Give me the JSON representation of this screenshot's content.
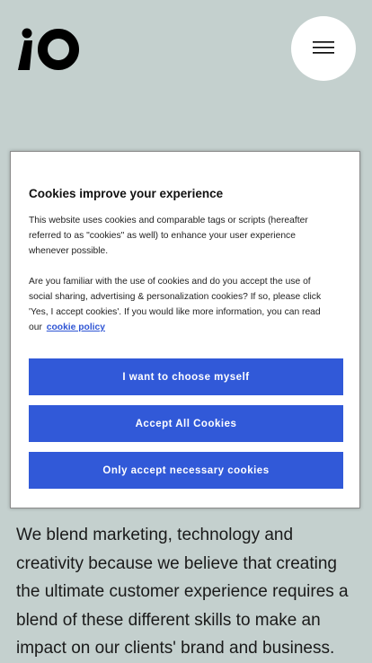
{
  "header": {
    "logo_icon": "io-logo-icon",
    "menu_icon": "hamburger-menu-icon"
  },
  "main": {
    "body_text": "We blend marketing, technology and creativity because we believe that creating the ultimate customer experience requires a blend of these different skills to make an impact on our clients' brand and business."
  },
  "cookie": {
    "title": "Cookies improve your experience",
    "paragraph1": "This website uses cookies and comparable tags or scripts (hereafter referred to as \"cookies\" as well) to enhance your user experience whenever possible.",
    "paragraph2": "Are you familiar with the use of cookies and do you accept the use of social sharing, advertising & personalization cookies? If so, please click 'Yes, I accept cookies'. If you would like more information, you can read our",
    "policy_link": "cookie policy",
    "choose_button": "I want to choose myself",
    "accept_all_button": "Accept All Cookies",
    "necessary_button": "Only accept necessary cookies"
  },
  "colors": {
    "background": "#c4d0ce",
    "button": "#3159d8",
    "link": "#2f55d4",
    "text": "#1a1a1a"
  }
}
